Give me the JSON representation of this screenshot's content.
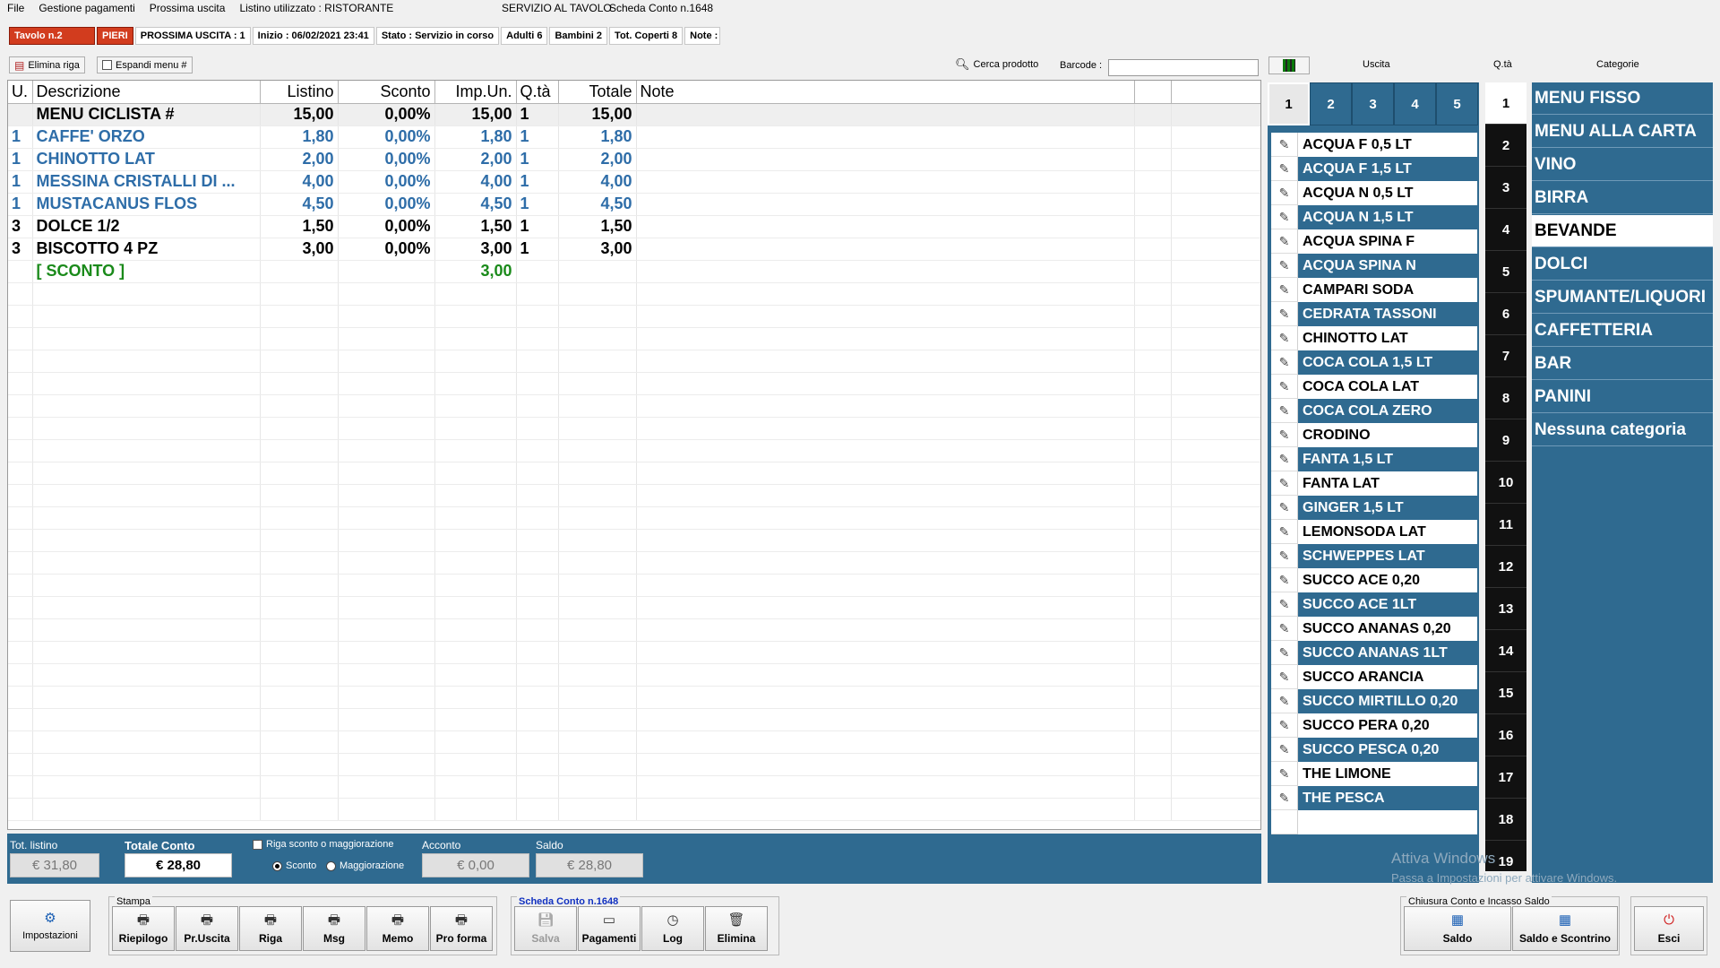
{
  "menu": [
    "File",
    "Gestione pagamenti",
    "Prossima uscita",
    "Listino utilizzato : RISTORANTE"
  ],
  "window_title": "SERVIZIO AL TAVOLO",
  "window_subtitle": "Scheda Conto n.1648",
  "status": {
    "table": "Tavolo n.2",
    "waiter": "PIERI",
    "next_exit": "PROSSIMA USCITA : 1",
    "start": "Inizio : 06/02/2021 23:41",
    "state": "Stato : Servizio in corso",
    "adults": "Adulti 6",
    "children": "Bambini 2",
    "covers": "Tot. Coperti 8",
    "notes": "Note :"
  },
  "toolbar": {
    "delete_row": "Elimina riga",
    "expand_menu": "Espandi menu #",
    "search_product": "Cerca prodotto",
    "barcode_label": "Barcode :",
    "barcode_value": ""
  },
  "columns": [
    "U.",
    "Descrizione",
    "Listino",
    "Sconto",
    "Imp.Un.",
    "Q.tà",
    "Totale",
    "Note"
  ],
  "rows": [
    {
      "u": "",
      "desc": "MENU CICLISTA #",
      "listino": "15,00",
      "sconto": "0,00%",
      "imp": "15,00",
      "qta": "1",
      "tot": "15,00",
      "style": "sel"
    },
    {
      "u": "1",
      "desc": "CAFFE' ORZO",
      "listino": "1,80",
      "sconto": "0,00%",
      "imp": "1,80",
      "qta": "1",
      "tot": "1,80",
      "style": "blue"
    },
    {
      "u": "1",
      "desc": "CHINOTTO LAT",
      "listino": "2,00",
      "sconto": "0,00%",
      "imp": "2,00",
      "qta": "1",
      "tot": "2,00",
      "style": "blue"
    },
    {
      "u": "1",
      "desc": "MESSINA CRISTALLI DI ...",
      "listino": "4,00",
      "sconto": "0,00%",
      "imp": "4,00",
      "qta": "1",
      "tot": "4,00",
      "style": "blue"
    },
    {
      "u": "1",
      "desc": "MUSTACANUS FLOS",
      "listino": "4,50",
      "sconto": "0,00%",
      "imp": "4,50",
      "qta": "1",
      "tot": "4,50",
      "style": "blue"
    },
    {
      "u": "3",
      "desc": "DOLCE 1/2",
      "listino": "1,50",
      "sconto": "0,00%",
      "imp": "1,50",
      "qta": "1",
      "tot": "1,50",
      "style": "black"
    },
    {
      "u": "3",
      "desc": "BISCOTTO 4 PZ",
      "listino": "3,00",
      "sconto": "0,00%",
      "imp": "3,00",
      "qta": "1",
      "tot": "3,00",
      "style": "black"
    },
    {
      "u": "",
      "desc": "[ SCONTO ]",
      "listino": "",
      "sconto": "",
      "imp": "3,00",
      "qta": "",
      "tot": "",
      "style": "green"
    }
  ],
  "totals": {
    "tot_listino_label": "Tot. listino",
    "tot_listino": "€ 31,80",
    "totale_conto_label": "Totale Conto",
    "totale_conto": "€ 28,80",
    "discount_row_label": "Riga sconto o maggiorazione",
    "sconto_radio": "Sconto",
    "magg_radio": "Maggiorazione",
    "acconto_label": "Acconto",
    "acconto": "€ 0,00",
    "saldo_label": "Saldo",
    "saldo": "€ 28,80"
  },
  "right_headers": {
    "uscita": "Uscita",
    "qta": "Q.tà",
    "categorie": "Categorie"
  },
  "exits": [
    "1",
    "2",
    "3",
    "4",
    "5"
  ],
  "products": [
    "ACQUA F 0,5 LT",
    "ACQUA F 1,5 LT",
    "ACQUA N 0,5 LT",
    "ACQUA N 1,5 LT",
    "ACQUA SPINA F",
    "ACQUA SPINA N",
    "CAMPARI SODA",
    "CEDRATA TASSONI",
    "CHINOTTO LAT",
    "COCA COLA 1,5 LT",
    "COCA COLA LAT",
    "COCA COLA ZERO",
    "CRODINO",
    "FANTA 1,5 LT",
    "FANTA LAT",
    "GINGER 1,5 LT",
    "LEMONSODA LAT",
    "SCHWEPPES LAT",
    "SUCCO ACE 0,20",
    "SUCCO ACE 1LT",
    "SUCCO ANANAS 0,20",
    "SUCCO ANANAS 1LT",
    "SUCCO ARANCIA",
    "SUCCO MIRTILLO 0,20",
    "SUCCO PERA 0,20",
    "SUCCO PESCA 0,20",
    "THE LIMONE",
    "THE PESCA"
  ],
  "quantities": [
    "1",
    "2",
    "3",
    "4",
    "5",
    "6",
    "7",
    "8",
    "9",
    "10",
    "11",
    "12",
    "13",
    "14",
    "15",
    "16",
    "17",
    "18",
    "19"
  ],
  "categories": [
    "MENU FISSO",
    "MENU ALLA CARTA",
    "VINO",
    "BIRRA",
    "BEVANDE",
    "DOLCI",
    "SPUMANTE/LIQUORI",
    "CAFFETTERIA",
    "BAR",
    "PANINI",
    "Nessuna categoria"
  ],
  "active_category": "BEVANDE",
  "watermark": {
    "line1": "Attiva Windows",
    "line2": "Passa a Impostazioni per attivare Windows."
  },
  "buttons": {
    "impostazioni": "Impostazioni",
    "stampa_group": "Stampa",
    "riepilogo": "Riepilogo",
    "pruscita": "Pr.Uscita",
    "riga": "Riga",
    "msg": "Msg",
    "memo": "Memo",
    "proforma": "Pro forma",
    "scheda_group": "Scheda Conto n.1648",
    "salva": "Salva",
    "pagamenti": "Pagamenti",
    "log": "Log",
    "elimina": "Elimina",
    "chiusura_group": "Chiusura Conto e Incasso Saldo",
    "saldo": "Saldo",
    "saldo_scontrino": "Saldo e Scontrino",
    "esci": "Esci"
  },
  "colors": {
    "panel_blue": "#2f6a90",
    "accent_red": "#d23c1e",
    "row_blue": "#2e6da8",
    "discount_green": "#1a8a1a"
  }
}
